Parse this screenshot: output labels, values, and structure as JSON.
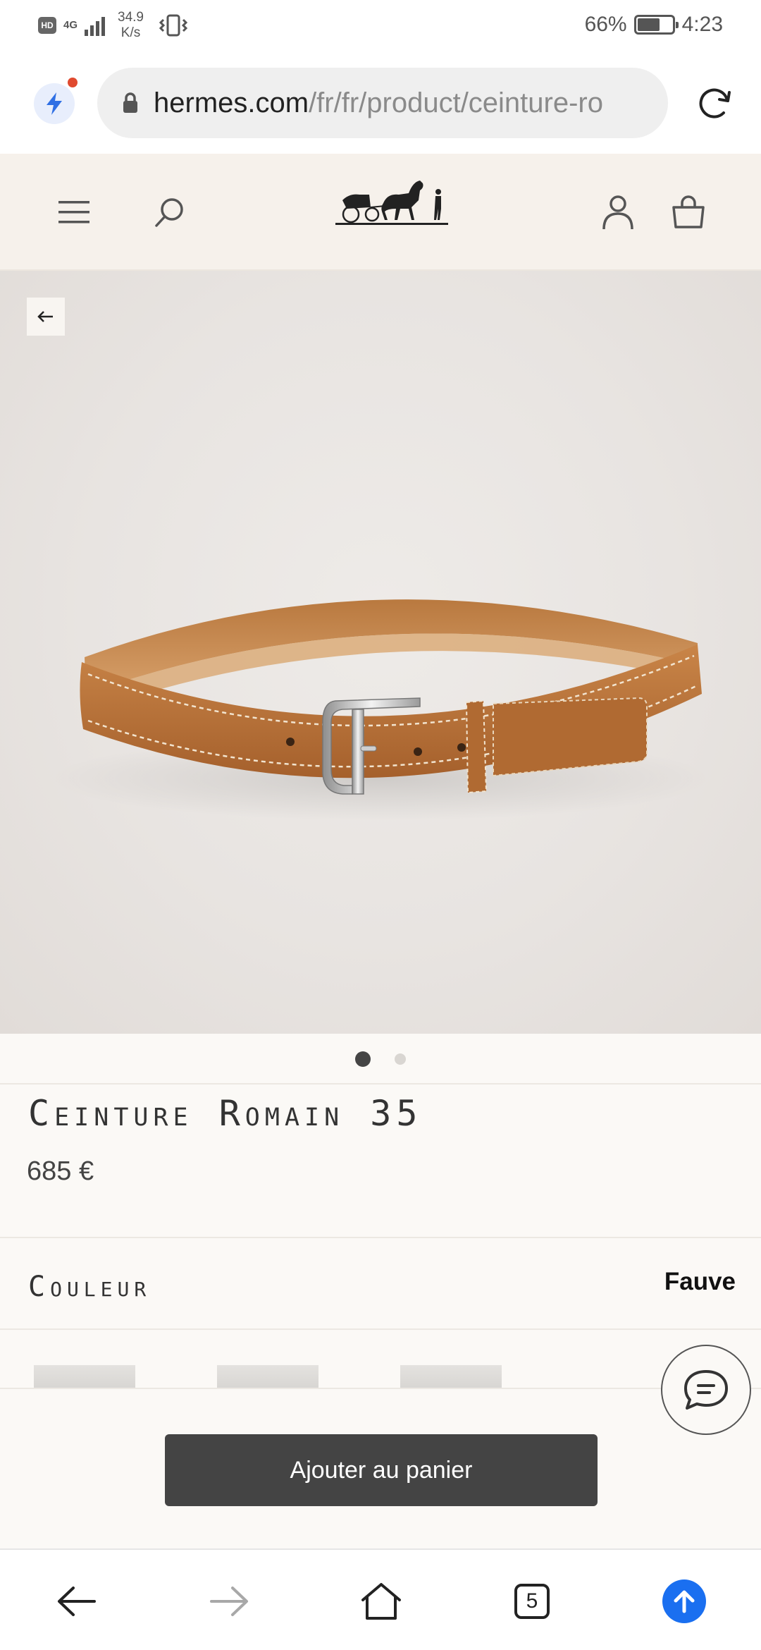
{
  "status_bar": {
    "hd_label": "HD",
    "network_type": "4G",
    "speed_value": "34.9",
    "speed_unit": "K/s",
    "battery_percent": "66%",
    "battery_level": 0.66,
    "time": "4:23"
  },
  "browser": {
    "url_host": "hermes.com",
    "url_path": "/fr/fr/product/ceinture-ro",
    "tab_count": "5",
    "accent_color": "#1a6ff0"
  },
  "site_header": {
    "logo_icon": "hermes-caleche-logo",
    "menu_icon": "hamburger-menu-icon",
    "search_icon": "search-icon",
    "account_icon": "account-icon",
    "cart_icon": "shopping-bag-icon"
  },
  "product": {
    "title": "Ceinture Romain 35",
    "price": "685 €",
    "color_label": "Couleur",
    "color_value": "Fauve",
    "image_count": 2,
    "active_image": 1,
    "add_to_cart_label": "Ajouter au panier",
    "belt_color": "#b8733a"
  }
}
